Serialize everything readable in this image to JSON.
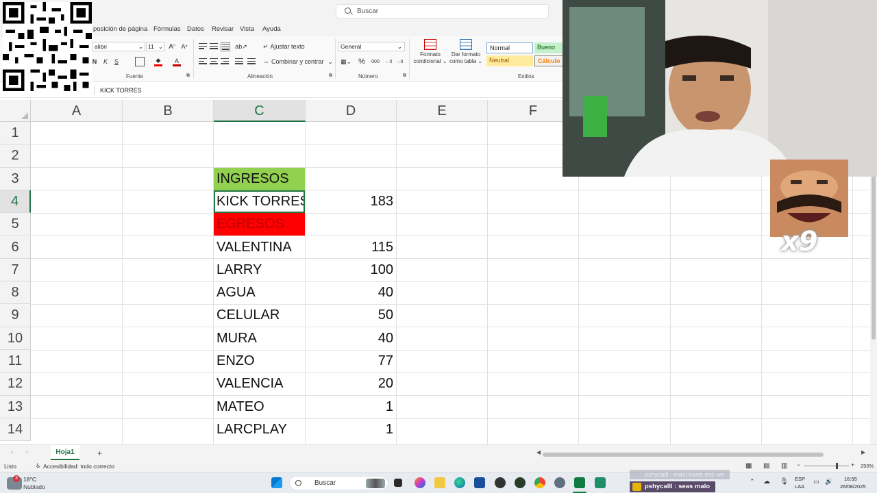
{
  "search": {
    "placeholder": "Buscar"
  },
  "menu": {
    "tabs": [
      "posición de página",
      "Fórmulas",
      "Datos",
      "Revisar",
      "Vista",
      "Ayuda"
    ]
  },
  "ribbon": {
    "font_name": "alibri",
    "font_size": "11",
    "grp_fuente": "Fuente",
    "grp_alineacion": "Alineación",
    "grp_numero": "Número",
    "grp_estilos": "Estilos",
    "wrap_text": "Ajustar texto",
    "merge_center": "Combinar y centrar",
    "number_format": "General",
    "cond_format_1": "Formato",
    "cond_format_2": "condicional",
    "table_format_1": "Dar formato",
    "table_format_2": "como tabla",
    "styles": {
      "normal": "Normal",
      "bueno": "Bueno",
      "neutral": "Neutral",
      "calculo": "Cálculo"
    },
    "btn_grow": "A",
    "btn_shrink": "A",
    "btn_italic": "K",
    "btn_underline": "S",
    "percent": "%",
    "thousands": "000"
  },
  "formula_bar": {
    "content": "KICK TORRES"
  },
  "grid": {
    "columns": [
      "A",
      "B",
      "C",
      "D",
      "E",
      "F"
    ],
    "rows": [
      "1",
      "2",
      "3",
      "4",
      "5",
      "6",
      "7",
      "8",
      "9",
      "10",
      "11",
      "12",
      "13",
      "14"
    ],
    "selected_column": "C",
    "selected_row": "4",
    "cells": {
      "c3": "INGRESOS",
      "c4": "KICK TORRES",
      "d4": "183",
      "c5": "EGRESOS",
      "c6": "VALENTINA",
      "d6": "115",
      "c7": "LARRY",
      "d7": "100",
      "c8": "AGUA",
      "d8": "40",
      "c9": "CELULAR",
      "d9": "50",
      "c10": "MURA",
      "d10": "40",
      "c11": "ENZO",
      "d11": "77",
      "c12": "VALENCIA",
      "d12": "20",
      "c13": "MATEO",
      "d13": "1",
      "c14": "LARCPLAY",
      "d14": "1"
    }
  },
  "sheets": {
    "active": "Hoja1",
    "add": "+"
  },
  "status": {
    "ready": "Listo",
    "accessibility": "Accesibilidad: todo correcto",
    "zoom": "250%"
  },
  "taskbar": {
    "weather_temp": "18°C",
    "weather_desc": "Nublado",
    "weather_badge": "3",
    "search": "Buscar",
    "lang_1": "ESP",
    "lang_2": "LAA",
    "time": "16:55",
    "date": "26/08/2025"
  },
  "overlay": {
    "meme_multiplier": "x9",
    "chat_user": "pshycalll",
    "chat_message": "pshycalll : seas malo",
    "chat_faded": "pshycalll : maol borre eso we"
  },
  "colors": {
    "excel_green": "#217346",
    "ingresos_fill": "#92d050",
    "egresos_fill": "#ff0000",
    "egresos_text": "#c00000",
    "neutral_fill": "#ffeb9c",
    "bueno_fill": "#c6efce"
  }
}
